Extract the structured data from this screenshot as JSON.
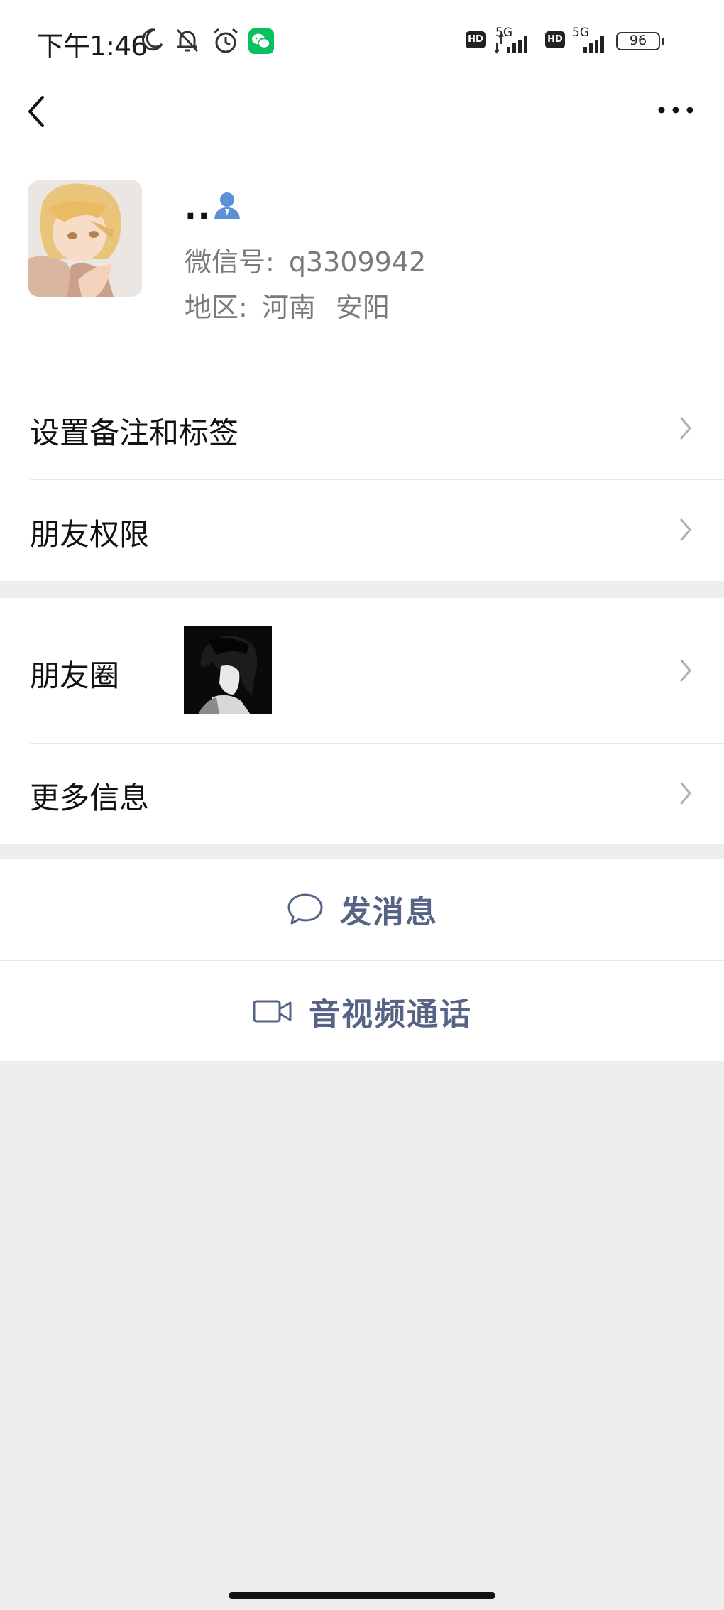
{
  "status_bar": {
    "time": "下午1:46",
    "network_1": "5G",
    "network_2": "5G",
    "hd_1": "HD",
    "hd_2": "HD",
    "battery_level": "96",
    "icons": [
      "moon-icon",
      "mute-icon",
      "alarm-icon",
      "wechat-notification-icon",
      "signal-icon",
      "battery-icon"
    ]
  },
  "header": {
    "back_icon": "chevron-left-icon",
    "more_icon": "more-dots-icon"
  },
  "profile": {
    "nickname": "..",
    "wechat_id_label": "微信号:",
    "wechat_id": "q3309942",
    "region_label": "地区:",
    "region_province": "河南",
    "region_city": "安阳"
  },
  "menu": {
    "remarks_tags": "设置备注和标签",
    "friend_permissions": "朋友权限",
    "moments": "朋友圈",
    "more_info": "更多信息"
  },
  "actions": {
    "send_message": "发消息",
    "av_call": "音视频通话"
  },
  "colors": {
    "background": "#ededed",
    "card": "#ffffff",
    "action_text": "#566384",
    "secondary_text": "#7a7a7a",
    "wechat_green": "#07c160",
    "contact_icon_blue": "#5b8fd6"
  }
}
